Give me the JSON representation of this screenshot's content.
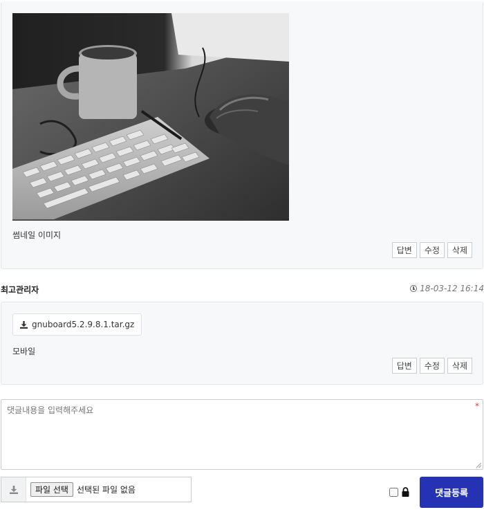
{
  "post": {
    "image_caption": "썸네일 이미지",
    "actions": [
      "답변",
      "수정",
      "삭제"
    ]
  },
  "comment": {
    "author": "최고관리자",
    "date": "18-03-12 16:14",
    "attachment": "gnuboard5.2.9.8.1.tar.gz",
    "body": "모바일",
    "actions": [
      "답변",
      "수정",
      "삭제"
    ]
  },
  "form": {
    "placeholder": "댓글내용을 입력해주세요",
    "required_mark": "*",
    "choose_file_label": "파일 선택",
    "no_file_label": "선택된 파일 없음",
    "submit_label": "댓글등록"
  },
  "colors": {
    "accent": "#2532b4",
    "required": "#e03b3b"
  }
}
